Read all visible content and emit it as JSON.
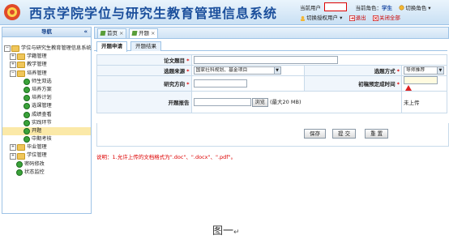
{
  "header": {
    "title": "西京学院学位与研究生教育管理信息系统",
    "current_user_label": "当前用户",
    "current_role_label": "当前角色：",
    "current_role_value": "学生",
    "switch_role": "切换角色",
    "switch_user": "切换授权用户",
    "logout": "退出",
    "close_all": "关闭全部"
  },
  "sidebar": {
    "title": "导航",
    "collapse": "«",
    "items": [
      {
        "label": "学位与研究生教育管理信息系统"
      },
      {
        "label": "学籍管理"
      },
      {
        "label": "教学管理"
      },
      {
        "label": "培养管理"
      },
      {
        "label": "师生双选"
      },
      {
        "label": "培养方案"
      },
      {
        "label": "培养计划"
      },
      {
        "label": "选课管理"
      },
      {
        "label": "成绩查看"
      },
      {
        "label": "实践环节"
      },
      {
        "label": "开题"
      },
      {
        "label": "中期考核"
      },
      {
        "label": "毕业管理"
      },
      {
        "label": "学位管理"
      },
      {
        "label": "密码修改"
      },
      {
        "label": "状态监控"
      }
    ]
  },
  "tabs": [
    {
      "label": "首页",
      "close": "×"
    },
    {
      "label": "开题",
      "close": "×"
    }
  ],
  "subtabs": [
    "开题申请",
    "开题结果"
  ],
  "form": {
    "thesis_title_label": "论文题目",
    "source_label": "选题来源",
    "source_value": "国家社科规划、基金项目",
    "method_label": "选题方式",
    "method_value": "导师推荐",
    "direction_label": "研究方向",
    "planned_time_label": "初稿预定成时间",
    "report_label": "开题报告",
    "browse_label": "浏览",
    "max_size": "(最大20 MB)",
    "upload_status": "未上传",
    "required_mark": "*"
  },
  "buttons": {
    "save": "保存",
    "submit": "提 交",
    "reset": "重 置"
  },
  "note": "说明：1.允许上传的文档格式为\".doc\"、\".docx\"、\".pdf\"。",
  "caption": {
    "text": "图一",
    "mark": "↵"
  },
  "colors": {
    "header_title": "#1b4f9c",
    "accent_border": "#9ec3e6",
    "note_red": "#dd0000",
    "selected_row": "#fbe9a8"
  }
}
